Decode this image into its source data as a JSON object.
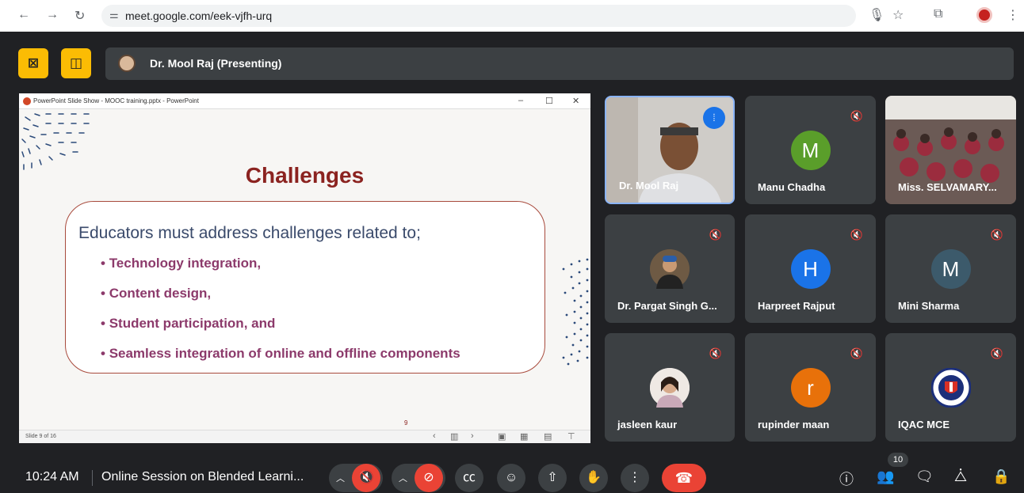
{
  "browser": {
    "url": "meet.google.com/eek-vjfh-urq",
    "icons": [
      "back-icon",
      "forward-icon",
      "reload-icon",
      "site-settings-icon",
      "mic-icon",
      "bookmark-star-icon",
      "extensions-icon",
      "profile-icon",
      "menu-icon"
    ]
  },
  "header": {
    "presenter": "Dr. Mool Raj (Presenting)"
  },
  "ppt": {
    "title": "PowerPoint Slide Show - MOOC training.pptx - PowerPoint",
    "status": "Slide 9 of 16",
    "slide": {
      "title": "Challenges",
      "intro": "Educators must address challenges related to;",
      "bullets": [
        "Technology integration,",
        "Content design,",
        "Student participation, and",
        "Seamless integration of online and offline components"
      ],
      "page_num": "9"
    }
  },
  "participants": [
    {
      "name": "Dr. Mool Raj",
      "type": "video"
    },
    {
      "name": "Manu Chadha",
      "initial": "M",
      "color": "#5a9e2a"
    },
    {
      "name": "Miss. SELVAMARY...",
      "type": "video"
    },
    {
      "name": "Dr. Pargat Singh G...",
      "type": "photo"
    },
    {
      "name": "Harpreet Rajput",
      "initial": "H",
      "color": "#1a73e8"
    },
    {
      "name": "Mini Sharma",
      "initial": "M",
      "color": "#3c5a6b"
    },
    {
      "name": "jasleen kaur",
      "type": "photo"
    },
    {
      "name": "rupinder maan",
      "initial": "r",
      "color": "#e8710a"
    },
    {
      "name": "IQAC MCE",
      "type": "logo"
    }
  ],
  "bottom": {
    "time": "10:24 AM",
    "meeting": "Online Session on Blended Learni...",
    "people_count": "10"
  }
}
